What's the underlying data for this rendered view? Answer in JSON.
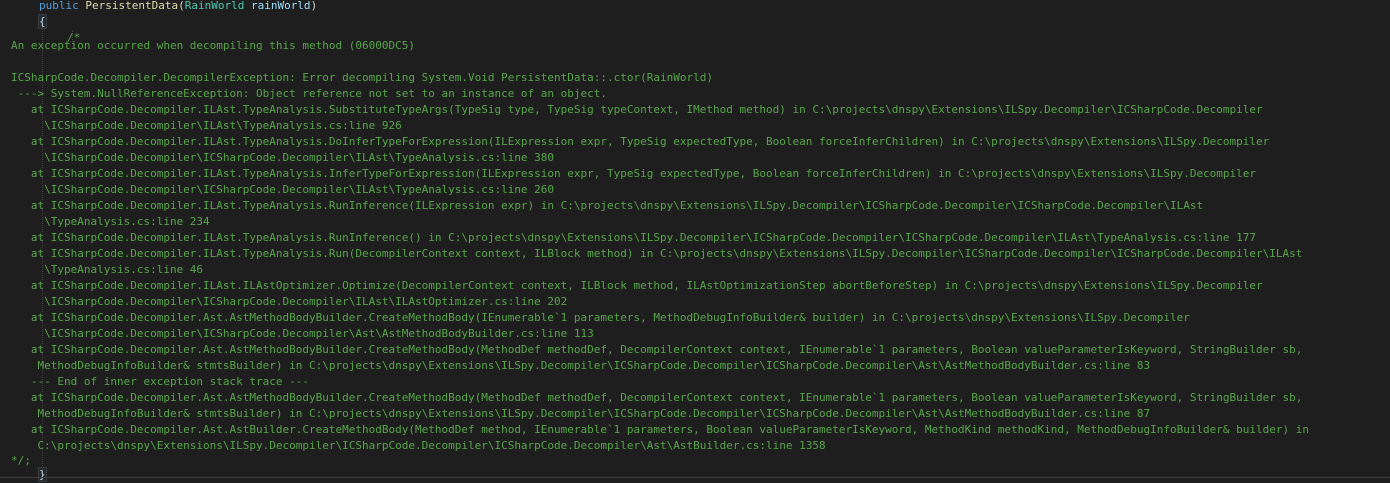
{
  "method_header": {
    "keyword": "public",
    "name": "PersistentData",
    "open_paren": "(",
    "param_type": "RainWorld",
    "param_name": "rainWorld",
    "close_paren": ")",
    "open_brace": "{",
    "comment_open": "/*"
  },
  "comment_lines": [
    "An exception occurred when decompiling this method (06000DC5)",
    "",
    "ICSharpCode.Decompiler.DecompilerException: Error decompiling System.Void PersistentData::.ctor(RainWorld)",
    " ---> System.NullReferenceException: Object reference not set to an instance of an object.",
    "   at ICSharpCode.Decompiler.ILAst.TypeAnalysis.SubstituteTypeArgs(TypeSig type, TypeSig typeContext, IMethod method) in C:\\projects\\dnspy\\Extensions\\ILSpy.Decompiler\\ICSharpCode.Decompiler",
    "     \\ICSharpCode.Decompiler\\ILAst\\TypeAnalysis.cs:line 926",
    "   at ICSharpCode.Decompiler.ILAst.TypeAnalysis.DoInferTypeForExpression(ILExpression expr, TypeSig expectedType, Boolean forceInferChildren) in C:\\projects\\dnspy\\Extensions\\ILSpy.Decompiler",
    "     \\ICSharpCode.Decompiler\\ICSharpCode.Decompiler\\ILAst\\TypeAnalysis.cs:line 380",
    "   at ICSharpCode.Decompiler.ILAst.TypeAnalysis.InferTypeForExpression(ILExpression expr, TypeSig expectedType, Boolean forceInferChildren) in C:\\projects\\dnspy\\Extensions\\ILSpy.Decompiler",
    "     \\ICSharpCode.Decompiler\\ICSharpCode.Decompiler\\ILAst\\TypeAnalysis.cs:line 260",
    "   at ICSharpCode.Decompiler.ILAst.TypeAnalysis.RunInference(ILExpression expr) in C:\\projects\\dnspy\\Extensions\\ILSpy.Decompiler\\ICSharpCode.Decompiler\\ICSharpCode.Decompiler\\ILAst",
    "     \\TypeAnalysis.cs:line 234",
    "   at ICSharpCode.Decompiler.ILAst.TypeAnalysis.RunInference() in C:\\projects\\dnspy\\Extensions\\ILSpy.Decompiler\\ICSharpCode.Decompiler\\ICSharpCode.Decompiler\\ILAst\\TypeAnalysis.cs:line 177",
    "   at ICSharpCode.Decompiler.ILAst.TypeAnalysis.Run(DecompilerContext context, ILBlock method) in C:\\projects\\dnspy\\Extensions\\ILSpy.Decompiler\\ICSharpCode.Decompiler\\ICSharpCode.Decompiler\\ILAst",
    "     \\TypeAnalysis.cs:line 46",
    "   at ICSharpCode.Decompiler.ILAst.ILAstOptimizer.Optimize(DecompilerContext context, ILBlock method, ILAstOptimizationStep abortBeforeStep) in C:\\projects\\dnspy\\Extensions\\ILSpy.Decompiler",
    "     \\ICSharpCode.Decompiler\\ICSharpCode.Decompiler\\ILAst\\ILAstOptimizer.cs:line 202",
    "   at ICSharpCode.Decompiler.Ast.AstMethodBodyBuilder.CreateMethodBody(IEnumerable`1 parameters, MethodDebugInfoBuilder& builder) in C:\\projects\\dnspy\\Extensions\\ILSpy.Decompiler",
    "     \\ICSharpCode.Decompiler\\ICSharpCode.Decompiler\\Ast\\AstMethodBodyBuilder.cs:line 113",
    "   at ICSharpCode.Decompiler.Ast.AstMethodBodyBuilder.CreateMethodBody(MethodDef methodDef, DecompilerContext context, IEnumerable`1 parameters, Boolean valueParameterIsKeyword, StringBuilder sb,",
    "    MethodDebugInfoBuilder& stmtsBuilder) in C:\\projects\\dnspy\\Extensions\\ILSpy.Decompiler\\ICSharpCode.Decompiler\\ICSharpCode.Decompiler\\Ast\\AstMethodBodyBuilder.cs:line 83",
    "   --- End of inner exception stack trace ---",
    "   at ICSharpCode.Decompiler.Ast.AstMethodBodyBuilder.CreateMethodBody(MethodDef methodDef, DecompilerContext context, IEnumerable`1 parameters, Boolean valueParameterIsKeyword, StringBuilder sb,",
    "    MethodDebugInfoBuilder& stmtsBuilder) in C:\\projects\\dnspy\\Extensions\\ILSpy.Decompiler\\ICSharpCode.Decompiler\\ICSharpCode.Decompiler\\Ast\\AstMethodBodyBuilder.cs:line 87",
    "   at ICSharpCode.Decompiler.Ast.AstBuilder.CreateMethodBody(MethodDef method, IEnumerable`1 parameters, Boolean valueParameterIsKeyword, MethodKind methodKind, MethodDebugInfoBuilder& builder) in",
    "    C:\\projects\\dnspy\\Extensions\\ILSpy.Decompiler\\ICSharpCode.Decompiler\\ICSharpCode.Decompiler\\Ast\\AstBuilder.cs:line 1358"
  ],
  "comment_close": "*/;",
  "close_brace": "}",
  "colors": {
    "background": "#1e1e1e",
    "keyword": "#569cd6",
    "method": "#dcdcaa",
    "type": "#4ec9b0",
    "parameter": "#9cdcfe",
    "comment": "#57a64a"
  }
}
